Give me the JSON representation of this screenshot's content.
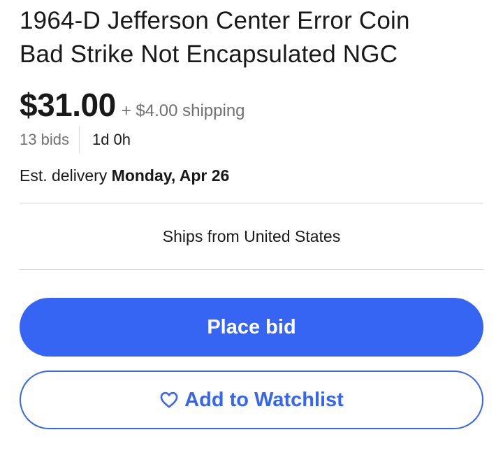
{
  "listing": {
    "title_line1": "1964-D Jefferson Center Error Coin",
    "title_line2": "Bad Strike Not Encapsulated NGC",
    "price": "$31.00",
    "shipping": "+ $4.00 shipping",
    "bids": "13 bids",
    "time_left": "1d 0h",
    "delivery_prefix": "Est. delivery ",
    "delivery_date": "Monday, Apr 26",
    "ships_from": "Ships from United States"
  },
  "actions": {
    "place_bid_label": "Place bid",
    "watchlist_label": "Add to Watchlist",
    "watchlist_icon": "heart-outline-icon"
  },
  "colors": {
    "accent": "#3665f3",
    "text": "#191919",
    "muted": "#707070",
    "divider": "#d8d8d8"
  }
}
